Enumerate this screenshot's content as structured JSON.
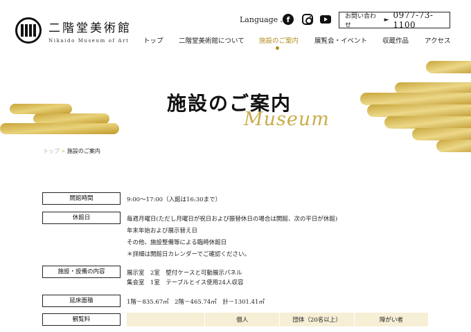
{
  "header": {
    "logo_jp": "二階堂美術館",
    "logo_en": "Nikaido Museum of Art",
    "language": "Language",
    "contact_label": "お問い合わせ",
    "contact_arrow": "►",
    "tel": "0977-73-1100",
    "sns": {
      "facebook": "f"
    }
  },
  "nav": [
    "トップ",
    "二階堂美術館について",
    "施設のご案内",
    "展覧会・イベント",
    "収蔵作品",
    "アクセス"
  ],
  "hero": {
    "title": "施設のご案内",
    "script": "Museum"
  },
  "breadcrumb": {
    "home": "トップ",
    "sep": "»",
    "current": "施設のご案内"
  },
  "info": {
    "hours_label": "開館時間",
    "hours": "9:00～17:00（入館は16:30まで）",
    "closed_label": "休館日",
    "closed_1": "毎週月曜日(ただし月曜日が祝日および振替休日の場合は開館、次の平日が休館)",
    "closed_2": "年末年始および展示替え日",
    "closed_3": "その他、施設整備等による臨時休館日",
    "closed_4": "＊詳細は開館日カレンダーでご確認ください。",
    "facility_label": "施設・設備の内容",
    "facility_1": "展示室　2室　壁付ケースと可動展示パネル",
    "facility_2": "集会室　1室　テーブルとイス使用24人収容",
    "area_label": "延床面積",
    "area": "1階－835.67㎡　2階－465.74㎡　計－1301.41㎡",
    "fee_label": "観覧料",
    "fee_headers": [
      "",
      "個人",
      "団体（20名以上）",
      "障がい者"
    ]
  },
  "colors": {
    "gold": "#b08d1e",
    "gold_light": "#c9ad4b",
    "table_header": "#f6efd6"
  }
}
